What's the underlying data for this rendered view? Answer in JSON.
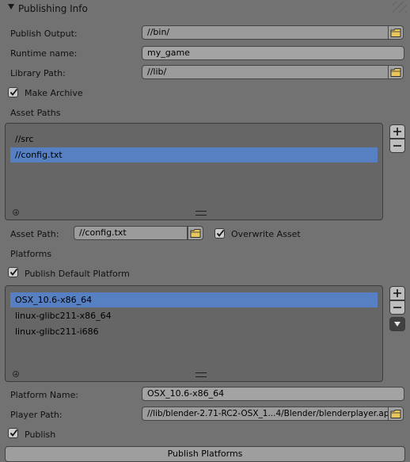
{
  "panel": {
    "title": "Publishing Info"
  },
  "publish_output": {
    "label": "Publish Output:",
    "value": "//bin/"
  },
  "runtime_name": {
    "label": "Runtime name:",
    "value": "my_game"
  },
  "library_path": {
    "label": "Library Path:",
    "value": "//lib/"
  },
  "make_archive": {
    "label": "Make Archive",
    "checked": true
  },
  "asset_paths": {
    "heading": "Asset Paths",
    "items": [
      "//src",
      "//config.txt"
    ],
    "selected_index": 1
  },
  "asset_path": {
    "label": "Asset Path:",
    "value": "//config.txt"
  },
  "overwrite_asset": {
    "label": "Overwrite Asset",
    "checked": true
  },
  "platforms": {
    "heading": "Platforms",
    "publish_default": {
      "label": "Publish Default Platform",
      "checked": true
    },
    "items": [
      "OSX_10.6-x86_64",
      "linux-glibc211-x86_64",
      "linux-glibc211-i686"
    ],
    "selected_index": 0
  },
  "platform_name": {
    "label": "Platform Name:",
    "value": "OSX_10.6-x86_64"
  },
  "player_path": {
    "label": "Player Path:",
    "value": "//lib/blender-2.71-RC2-OSX_1...4/Blender/blenderplayer.app"
  },
  "publish": {
    "label": "Publish",
    "checked": true
  },
  "publish_platforms_button": {
    "label": "Publish Platforms"
  }
}
